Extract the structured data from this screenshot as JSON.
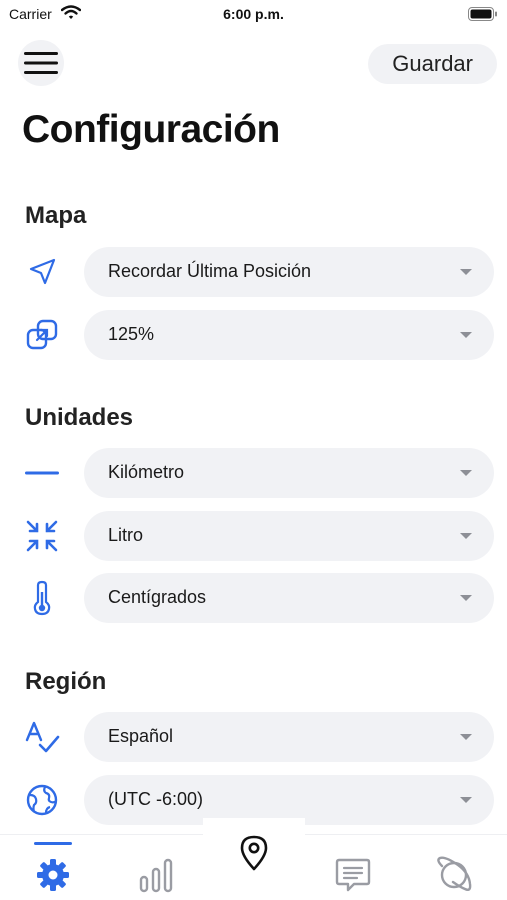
{
  "status_bar": {
    "carrier": "Carrier",
    "time": "6:00 p.m.",
    "wifi_icon": "wifi-icon",
    "battery_icon": "battery-icon"
  },
  "header": {
    "menu_icon": "hamburger-menu-icon",
    "save_label": "Guardar",
    "title": "Configuración"
  },
  "sections": {
    "map": {
      "title": "Mapa",
      "rows": [
        {
          "icon": "navigation-arrow-icon",
          "value": "Recordar Última Posición"
        },
        {
          "icon": "scale-squares-icon",
          "value": "125%"
        }
      ]
    },
    "units": {
      "title": "Unidades",
      "rows": [
        {
          "icon": "horizontal-line-icon",
          "value": "Kilómetro"
        },
        {
          "icon": "compress-arrows-icon",
          "value": "Litro"
        },
        {
          "icon": "thermometer-icon",
          "value": "Centígrados"
        }
      ]
    },
    "region": {
      "title": "Región",
      "rows": [
        {
          "icon": "language-spellcheck-icon",
          "value": "Español"
        },
        {
          "icon": "globe-icon",
          "value": "(UTC -6:00)"
        }
      ]
    }
  },
  "tab_bar": {
    "active_tab": "settings",
    "tabs": [
      "settings-gear-icon",
      "stats-bars-icon",
      "map-pin-icon",
      "messages-icon",
      "planet-icon"
    ]
  },
  "colors": {
    "accent": "#2f6be6",
    "field_bg": "#f1f2f5",
    "icon_gray": "#9a9ca3",
    "text": "#111111"
  }
}
